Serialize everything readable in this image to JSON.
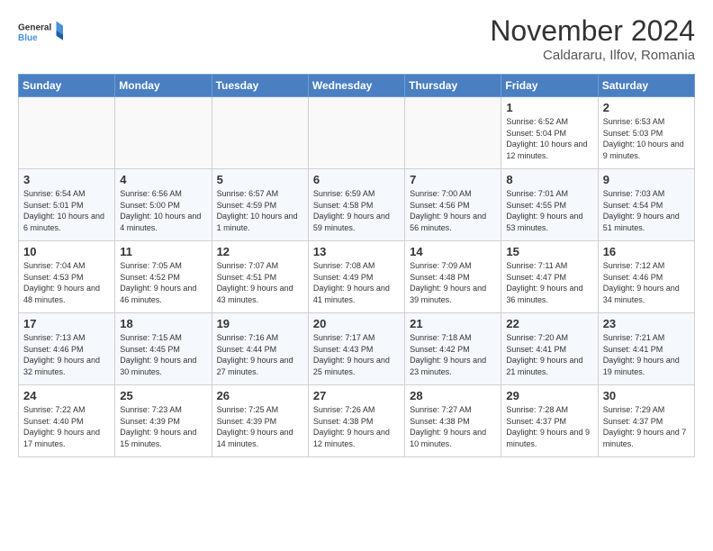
{
  "logo": {
    "line1": "General",
    "line2": "Blue"
  },
  "title": "November 2024",
  "subtitle": "Caldararu, Ilfov, Romania",
  "weekdays": [
    "Sunday",
    "Monday",
    "Tuesday",
    "Wednesday",
    "Thursday",
    "Friday",
    "Saturday"
  ],
  "weeks": [
    [
      {
        "day": "",
        "info": ""
      },
      {
        "day": "",
        "info": ""
      },
      {
        "day": "",
        "info": ""
      },
      {
        "day": "",
        "info": ""
      },
      {
        "day": "",
        "info": ""
      },
      {
        "day": "1",
        "info": "Sunrise: 6:52 AM\nSunset: 5:04 PM\nDaylight: 10 hours and 12 minutes."
      },
      {
        "day": "2",
        "info": "Sunrise: 6:53 AM\nSunset: 5:03 PM\nDaylight: 10 hours and 9 minutes."
      }
    ],
    [
      {
        "day": "3",
        "info": "Sunrise: 6:54 AM\nSunset: 5:01 PM\nDaylight: 10 hours and 6 minutes."
      },
      {
        "day": "4",
        "info": "Sunrise: 6:56 AM\nSunset: 5:00 PM\nDaylight: 10 hours and 4 minutes."
      },
      {
        "day": "5",
        "info": "Sunrise: 6:57 AM\nSunset: 4:59 PM\nDaylight: 10 hours and 1 minute."
      },
      {
        "day": "6",
        "info": "Sunrise: 6:59 AM\nSunset: 4:58 PM\nDaylight: 9 hours and 59 minutes."
      },
      {
        "day": "7",
        "info": "Sunrise: 7:00 AM\nSunset: 4:56 PM\nDaylight: 9 hours and 56 minutes."
      },
      {
        "day": "8",
        "info": "Sunrise: 7:01 AM\nSunset: 4:55 PM\nDaylight: 9 hours and 53 minutes."
      },
      {
        "day": "9",
        "info": "Sunrise: 7:03 AM\nSunset: 4:54 PM\nDaylight: 9 hours and 51 minutes."
      }
    ],
    [
      {
        "day": "10",
        "info": "Sunrise: 7:04 AM\nSunset: 4:53 PM\nDaylight: 9 hours and 48 minutes."
      },
      {
        "day": "11",
        "info": "Sunrise: 7:05 AM\nSunset: 4:52 PM\nDaylight: 9 hours and 46 minutes."
      },
      {
        "day": "12",
        "info": "Sunrise: 7:07 AM\nSunset: 4:51 PM\nDaylight: 9 hours and 43 minutes."
      },
      {
        "day": "13",
        "info": "Sunrise: 7:08 AM\nSunset: 4:49 PM\nDaylight: 9 hours and 41 minutes."
      },
      {
        "day": "14",
        "info": "Sunrise: 7:09 AM\nSunset: 4:48 PM\nDaylight: 9 hours and 39 minutes."
      },
      {
        "day": "15",
        "info": "Sunrise: 7:11 AM\nSunset: 4:47 PM\nDaylight: 9 hours and 36 minutes."
      },
      {
        "day": "16",
        "info": "Sunrise: 7:12 AM\nSunset: 4:46 PM\nDaylight: 9 hours and 34 minutes."
      }
    ],
    [
      {
        "day": "17",
        "info": "Sunrise: 7:13 AM\nSunset: 4:46 PM\nDaylight: 9 hours and 32 minutes."
      },
      {
        "day": "18",
        "info": "Sunrise: 7:15 AM\nSunset: 4:45 PM\nDaylight: 9 hours and 30 minutes."
      },
      {
        "day": "19",
        "info": "Sunrise: 7:16 AM\nSunset: 4:44 PM\nDaylight: 9 hours and 27 minutes."
      },
      {
        "day": "20",
        "info": "Sunrise: 7:17 AM\nSunset: 4:43 PM\nDaylight: 9 hours and 25 minutes."
      },
      {
        "day": "21",
        "info": "Sunrise: 7:18 AM\nSunset: 4:42 PM\nDaylight: 9 hours and 23 minutes."
      },
      {
        "day": "22",
        "info": "Sunrise: 7:20 AM\nSunset: 4:41 PM\nDaylight: 9 hours and 21 minutes."
      },
      {
        "day": "23",
        "info": "Sunrise: 7:21 AM\nSunset: 4:41 PM\nDaylight: 9 hours and 19 minutes."
      }
    ],
    [
      {
        "day": "24",
        "info": "Sunrise: 7:22 AM\nSunset: 4:40 PM\nDaylight: 9 hours and 17 minutes."
      },
      {
        "day": "25",
        "info": "Sunrise: 7:23 AM\nSunset: 4:39 PM\nDaylight: 9 hours and 15 minutes."
      },
      {
        "day": "26",
        "info": "Sunrise: 7:25 AM\nSunset: 4:39 PM\nDaylight: 9 hours and 14 minutes."
      },
      {
        "day": "27",
        "info": "Sunrise: 7:26 AM\nSunset: 4:38 PM\nDaylight: 9 hours and 12 minutes."
      },
      {
        "day": "28",
        "info": "Sunrise: 7:27 AM\nSunset: 4:38 PM\nDaylight: 9 hours and 10 minutes."
      },
      {
        "day": "29",
        "info": "Sunrise: 7:28 AM\nSunset: 4:37 PM\nDaylight: 9 hours and 9 minutes."
      },
      {
        "day": "30",
        "info": "Sunrise: 7:29 AM\nSunset: 4:37 PM\nDaylight: 9 hours and 7 minutes."
      }
    ]
  ]
}
